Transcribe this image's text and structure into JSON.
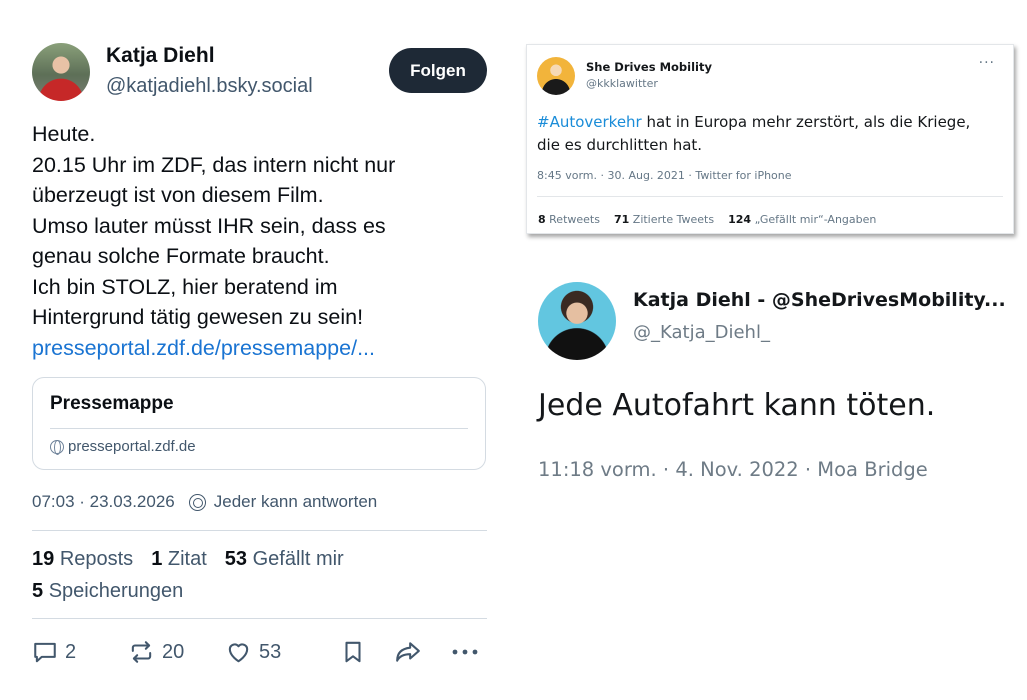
{
  "post": {
    "author_name": "Katja Diehl",
    "author_handle": "@katjadiehl.bsky.social",
    "follow_label": "Folgen",
    "text_lines": [
      "Heute.",
      "20.15 Uhr im ZDF, das intern nicht nur",
      "überzeugt ist von diesem Film.",
      "Umso lauter müsst IHR sein, dass es",
      "genau solche Formate braucht.",
      "Ich bin STOLZ, hier beratend im",
      "Hintergrund tätig gewesen zu sein!"
    ],
    "link_text": "presseportal.zdf.de/pressemappe/...",
    "embed": {
      "title": "Pressemappe",
      "domain": "presseportal.zdf.de"
    },
    "timestamp": "07:03 · 23.03.2026",
    "reply_setting": "Jeder kann antworten",
    "stats": {
      "reposts_count": "19",
      "reposts_label": "Reposts",
      "quotes_count": "1",
      "quotes_label": "Zitat",
      "likes_count": "53",
      "likes_label": "Gefällt mir",
      "saves_count": "5",
      "saves_label": "Speicherungen"
    },
    "actions": {
      "replies": "2",
      "reposts": "20",
      "likes": "53"
    },
    "icons": [
      "reply-icon",
      "repost-icon",
      "heart-icon",
      "bookmark-icon",
      "share-icon",
      "more-icon"
    ]
  },
  "tweet1": {
    "name": "She Drives Mobility",
    "handle": "@kkklawitter",
    "hashtag": "#Autoverkehr",
    "text_rest": " hat in Europa mehr zerstört, als die Kriege, die es durchlitten hat.",
    "date": "8:45 vorm. · 30. Aug. 2021 · Twitter for iPhone",
    "retweets_count": "8",
    "retweets_label": "Retweets",
    "quotes_count": "71",
    "quotes_label": "Zitierte Tweets",
    "likes_count": "124",
    "likes_label": "„Gefällt mir“-Angaben",
    "more": "···"
  },
  "tweet2": {
    "name": "Katja Diehl - @SheDrivesMobility...",
    "handle": "@_Katja_Diehl_",
    "text": "Jede Autofahrt kann töten.",
    "date": "11:18 vorm. · 4. Nov. 2022 · Moa Bridge"
  },
  "colors": {
    "link": "#1a74d2",
    "follow_bg": "#1e2936",
    "muted": "#42576c",
    "twitter_blue": "#1a8cd8"
  }
}
